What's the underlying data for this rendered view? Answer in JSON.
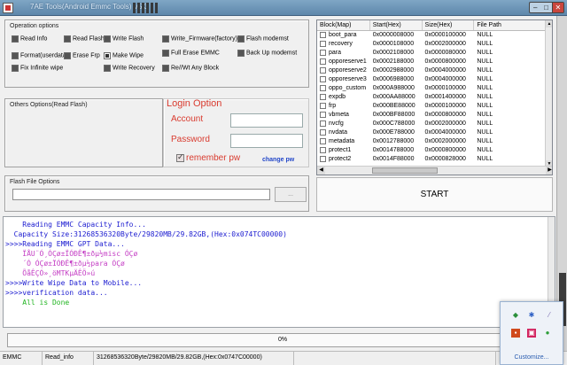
{
  "window": {
    "title": "7AE Tools(Android Emmc Tools) V5.3"
  },
  "operation_options": {
    "title": "Operation options",
    "items": [
      {
        "label": "Read Info"
      },
      {
        "label": "Read Flash"
      },
      {
        "label": "Write Flash"
      },
      {
        "label": "Write_Firmware(factory)"
      },
      {
        "label": "Flash modemst"
      },
      {
        "label": "Format(userdata)"
      },
      {
        "label": "Erase Frp"
      },
      {
        "label": "Make Wipe"
      },
      {
        "label": "Full Erase EMMC"
      },
      {
        "label": "Back Up modemst"
      },
      {
        "label": "Fix Infinite wipe"
      },
      {
        "label": "Write Recovery"
      },
      {
        "label": "Re//Wt Any Block"
      }
    ]
  },
  "others_options": {
    "title": "Others Options(Read Flash)"
  },
  "login": {
    "title": "Login Option",
    "account_label": "Account",
    "password_label": "Password",
    "remember_label": "remember pw",
    "change_pw": "change pw"
  },
  "table": {
    "headers": [
      "Block(Map)",
      "Start(Hex)",
      "Size(Hex)",
      "File Path"
    ],
    "rows": [
      {
        "block": "boot_para",
        "start": "0x0000008000",
        "size": "0x0000100000",
        "path": "NULL"
      },
      {
        "block": "recovery",
        "start": "0x0000108000",
        "size": "0x0002000000",
        "path": "NULL"
      },
      {
        "block": "para",
        "start": "0x0002108000",
        "size": "0x0000080000",
        "path": "NULL"
      },
      {
        "block": "opporeserve1",
        "start": "0x0002188000",
        "size": "0x0000800000",
        "path": "NULL"
      },
      {
        "block": "opporeserve2",
        "start": "0x0002988000",
        "size": "0x0004000000",
        "path": "NULL"
      },
      {
        "block": "opporeserve3",
        "start": "0x0006988000",
        "size": "0x0004000000",
        "path": "NULL"
      },
      {
        "block": "oppo_custom",
        "start": "0x000A988000",
        "size": "0x0000100000",
        "path": "NULL"
      },
      {
        "block": "expdb",
        "start": "0x000AA88000",
        "size": "0x0001400000",
        "path": "NULL"
      },
      {
        "block": "frp",
        "start": "0x000BE88000",
        "size": "0x0000100000",
        "path": "NULL"
      },
      {
        "block": "vbmeta",
        "start": "0x000BF88000",
        "size": "0x0000800000",
        "path": "NULL"
      },
      {
        "block": "nvcfg",
        "start": "0x000C788000",
        "size": "0x0002000000",
        "path": "NULL"
      },
      {
        "block": "nvdata",
        "start": "0x000E788000",
        "size": "0x0004000000",
        "path": "NULL"
      },
      {
        "block": "metadata",
        "start": "0x0012788000",
        "size": "0x0002000000",
        "path": "NULL"
      },
      {
        "block": "protect1",
        "start": "0x0014788000",
        "size": "0x0000800000",
        "path": "NULL"
      },
      {
        "block": "protect2",
        "start": "0x0014F88000",
        "size": "0x0000828000",
        "path": "NULL"
      }
    ]
  },
  "flash_file": {
    "title": "Flash File Options",
    "browse_label": "...",
    "path_value": ""
  },
  "start_button": "START",
  "log": {
    "lines": [
      {
        "text": "    Reading EMMC Capacity Info...",
        "color": "#1c1cd0"
      },
      {
        "text": "  Capacity Size:31268536320Byte/29820MB/29.82GB,(Hex:0x074TC00000)",
        "color": "#1c1cd0"
      },
      {
        "text": ">>>>Reading EMMC GPT Data...",
        "color": "#1c1cd0"
      },
      {
        "text": "    ÏÅU¨Ó¸ÓÇø±ÏÓÐÊ¶±ðµ½misc ÓÇø",
        "color": "#c43dc4"
      },
      {
        "text": "    ´Ó ÓÇø±ÏÓÐÊ¶±ðµ½para ÓÇø",
        "color": "#c43dc4"
      },
      {
        "text": "    ÕåÊÇÓ»¸öMTKµÄÊÖ»ú",
        "color": "#c43dc4"
      },
      {
        "text": ">>>>Write Wipe Data to Mobile...",
        "color": "#1c1cd0"
      },
      {
        "text": ">>>>verification data...",
        "color": "#1c1cd0"
      },
      {
        "text": "    All is Done",
        "color": "#21b521"
      }
    ]
  },
  "progress": {
    "value": 0,
    "label": "0%"
  },
  "statusbar": {
    "cells": [
      "EMMC",
      "Read_info",
      "31268536320Byte/29820MB/29.82GB,(Hex:0x0747C00000)",
      "",
      ""
    ]
  },
  "tray": {
    "customize_label": "Customize..."
  },
  "colors": {
    "login_red": "#d93b2f",
    "link_blue": "#2347c9",
    "log_blue": "#1c1cd0",
    "log_magenta": "#c43dc4",
    "log_green": "#21b521"
  }
}
